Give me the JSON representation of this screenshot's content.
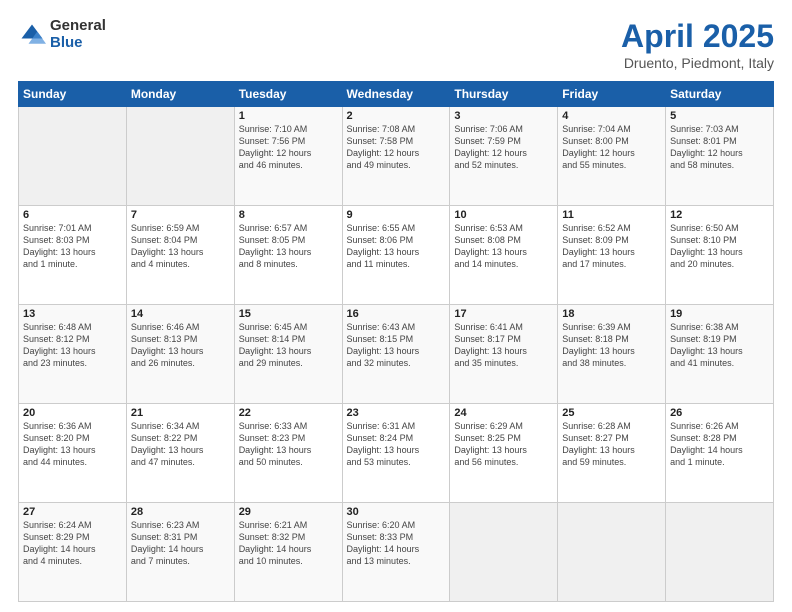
{
  "logo": {
    "general": "General",
    "blue": "Blue"
  },
  "title": {
    "month_year": "April 2025",
    "location": "Druento, Piedmont, Italy"
  },
  "headers": [
    "Sunday",
    "Monday",
    "Tuesday",
    "Wednesday",
    "Thursday",
    "Friday",
    "Saturday"
  ],
  "weeks": [
    [
      {
        "day": "",
        "info": ""
      },
      {
        "day": "",
        "info": ""
      },
      {
        "day": "1",
        "info": "Sunrise: 7:10 AM\nSunset: 7:56 PM\nDaylight: 12 hours\nand 46 minutes."
      },
      {
        "day": "2",
        "info": "Sunrise: 7:08 AM\nSunset: 7:58 PM\nDaylight: 12 hours\nand 49 minutes."
      },
      {
        "day": "3",
        "info": "Sunrise: 7:06 AM\nSunset: 7:59 PM\nDaylight: 12 hours\nand 52 minutes."
      },
      {
        "day": "4",
        "info": "Sunrise: 7:04 AM\nSunset: 8:00 PM\nDaylight: 12 hours\nand 55 minutes."
      },
      {
        "day": "5",
        "info": "Sunrise: 7:03 AM\nSunset: 8:01 PM\nDaylight: 12 hours\nand 58 minutes."
      }
    ],
    [
      {
        "day": "6",
        "info": "Sunrise: 7:01 AM\nSunset: 8:03 PM\nDaylight: 13 hours\nand 1 minute."
      },
      {
        "day": "7",
        "info": "Sunrise: 6:59 AM\nSunset: 8:04 PM\nDaylight: 13 hours\nand 4 minutes."
      },
      {
        "day": "8",
        "info": "Sunrise: 6:57 AM\nSunset: 8:05 PM\nDaylight: 13 hours\nand 8 minutes."
      },
      {
        "day": "9",
        "info": "Sunrise: 6:55 AM\nSunset: 8:06 PM\nDaylight: 13 hours\nand 11 minutes."
      },
      {
        "day": "10",
        "info": "Sunrise: 6:53 AM\nSunset: 8:08 PM\nDaylight: 13 hours\nand 14 minutes."
      },
      {
        "day": "11",
        "info": "Sunrise: 6:52 AM\nSunset: 8:09 PM\nDaylight: 13 hours\nand 17 minutes."
      },
      {
        "day": "12",
        "info": "Sunrise: 6:50 AM\nSunset: 8:10 PM\nDaylight: 13 hours\nand 20 minutes."
      }
    ],
    [
      {
        "day": "13",
        "info": "Sunrise: 6:48 AM\nSunset: 8:12 PM\nDaylight: 13 hours\nand 23 minutes."
      },
      {
        "day": "14",
        "info": "Sunrise: 6:46 AM\nSunset: 8:13 PM\nDaylight: 13 hours\nand 26 minutes."
      },
      {
        "day": "15",
        "info": "Sunrise: 6:45 AM\nSunset: 8:14 PM\nDaylight: 13 hours\nand 29 minutes."
      },
      {
        "day": "16",
        "info": "Sunrise: 6:43 AM\nSunset: 8:15 PM\nDaylight: 13 hours\nand 32 minutes."
      },
      {
        "day": "17",
        "info": "Sunrise: 6:41 AM\nSunset: 8:17 PM\nDaylight: 13 hours\nand 35 minutes."
      },
      {
        "day": "18",
        "info": "Sunrise: 6:39 AM\nSunset: 8:18 PM\nDaylight: 13 hours\nand 38 minutes."
      },
      {
        "day": "19",
        "info": "Sunrise: 6:38 AM\nSunset: 8:19 PM\nDaylight: 13 hours\nand 41 minutes."
      }
    ],
    [
      {
        "day": "20",
        "info": "Sunrise: 6:36 AM\nSunset: 8:20 PM\nDaylight: 13 hours\nand 44 minutes."
      },
      {
        "day": "21",
        "info": "Sunrise: 6:34 AM\nSunset: 8:22 PM\nDaylight: 13 hours\nand 47 minutes."
      },
      {
        "day": "22",
        "info": "Sunrise: 6:33 AM\nSunset: 8:23 PM\nDaylight: 13 hours\nand 50 minutes."
      },
      {
        "day": "23",
        "info": "Sunrise: 6:31 AM\nSunset: 8:24 PM\nDaylight: 13 hours\nand 53 minutes."
      },
      {
        "day": "24",
        "info": "Sunrise: 6:29 AM\nSunset: 8:25 PM\nDaylight: 13 hours\nand 56 minutes."
      },
      {
        "day": "25",
        "info": "Sunrise: 6:28 AM\nSunset: 8:27 PM\nDaylight: 13 hours\nand 59 minutes."
      },
      {
        "day": "26",
        "info": "Sunrise: 6:26 AM\nSunset: 8:28 PM\nDaylight: 14 hours\nand 1 minute."
      }
    ],
    [
      {
        "day": "27",
        "info": "Sunrise: 6:24 AM\nSunset: 8:29 PM\nDaylight: 14 hours\nand 4 minutes."
      },
      {
        "day": "28",
        "info": "Sunrise: 6:23 AM\nSunset: 8:31 PM\nDaylight: 14 hours\nand 7 minutes."
      },
      {
        "day": "29",
        "info": "Sunrise: 6:21 AM\nSunset: 8:32 PM\nDaylight: 14 hours\nand 10 minutes."
      },
      {
        "day": "30",
        "info": "Sunrise: 6:20 AM\nSunset: 8:33 PM\nDaylight: 14 hours\nand 13 minutes."
      },
      {
        "day": "",
        "info": ""
      },
      {
        "day": "",
        "info": ""
      },
      {
        "day": "",
        "info": ""
      }
    ]
  ]
}
